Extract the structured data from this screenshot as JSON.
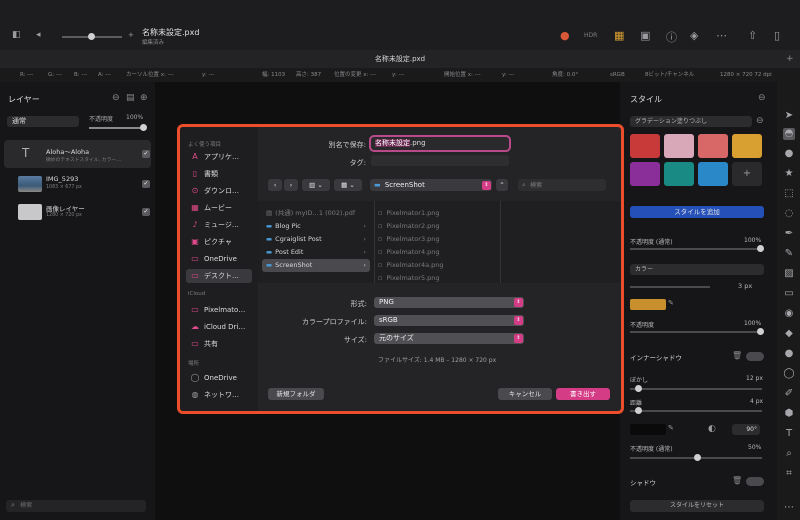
{
  "titlebar": {
    "doc_title": "名称未設定.pxd",
    "doc_subtitle": "編集済み",
    "hdr_label": "HDR",
    "tab_label": "名称未設定.pxd"
  },
  "infobar": {
    "r": "R: ---",
    "g": "G: ---",
    "b": "B: ---",
    "a": "A: ---",
    "cursor": "カーソル位置 x: ---",
    "y1": "y: ---",
    "width": "幅: 1103",
    "height": "高さ: 387",
    "posx": "位置の変更 x: ---",
    "y2": "y: ---",
    "startx": "開始位置 x: ---",
    "y3": "y: ---",
    "angle": "角度: 0.0°",
    "colorspace": "sRGB",
    "bits": "8ビット/チャンネル",
    "dims": "1280 × 720 72 dpi"
  },
  "layers_panel": {
    "title": "レイヤー",
    "blend": "通常",
    "opacity_label": "不透明度",
    "opacity_value": "100%",
    "layers": [
      {
        "name": "Aloha〜Aloha",
        "sub": "微妙のテキストスタイル, カラー…"
      },
      {
        "name": "IMG_5293",
        "sub": "1083 × 677 px"
      },
      {
        "name": "画像レイヤー",
        "sub": "1280 × 720 px"
      }
    ],
    "search_placeholder": "検索"
  },
  "dialog": {
    "save_as_label": "別名で保存:",
    "filename": "名称未設定.png",
    "filename_selected": "名称未設定",
    "filename_ext": ".png",
    "tags_label": "タグ:",
    "location": "ScreenShot",
    "search_placeholder": "検索",
    "sidebar": {
      "favorites_head": "よく使う項目",
      "favorites": [
        "アプリケ…",
        "書類",
        "ダウンロ…",
        "ムービー",
        "ミュージ…",
        "ピクチャ",
        "OneDrive",
        "デスクト…"
      ],
      "icloud_head": "iCloud",
      "icloud": [
        "Pixelmato…",
        "iCloud Dri…",
        "共有"
      ],
      "places_head": "場所",
      "places": [
        "OneDrive",
        "ネットワ…"
      ]
    },
    "col1": [
      "(共通) myID…1 (002).pdf",
      "Blog Pic",
      "Cgraiglist Post",
      "Post Edit",
      "ScreenShot"
    ],
    "col2": [
      "Pixelmator1.png",
      "Pixelmator2.png",
      "Pixelmator3.png",
      "Pixelmator4.png",
      "Pixelmator4a.png",
      "Pixelmator5.png"
    ],
    "format_label": "形式:",
    "format_value": "PNG",
    "profile_label": "カラープロファイル:",
    "profile_value": "sRGB",
    "size_label": "サイズ:",
    "size_value": "元のサイズ",
    "filesize": "ファイルサイズ:  1.4 MB – 1280 × 720 px",
    "new_folder": "新規フォルダ",
    "cancel": "キャンセル",
    "save": "書き出す"
  },
  "style_panel": {
    "title": "スタイル",
    "preset": "グラデーション塗りつぶし",
    "add_style": "スタイルを追加",
    "opacity_normal": "不透明度 (通常)",
    "opacity_normal_value": "100%",
    "fill_kind": "カラー",
    "px_value": "3 px",
    "opacity": "不透明度",
    "opacity_value": "100%",
    "inner_shadow": "インナーシャドウ",
    "blur": "ぼかし",
    "blur_value": "12 px",
    "distance": "距離",
    "distance_value": "4 px",
    "angle_value": "90°",
    "opacity_normal2": "不透明度 (通常)",
    "opacity_normal2_value": "50%",
    "shadow": "シャドウ",
    "reset_style": "スタイルをリセット"
  },
  "colors": {
    "accent_border": "#ea4e2b",
    "save_button": "#d43c86",
    "add_style_button": "#2450b8",
    "swatch_orange": "#c8902c"
  }
}
